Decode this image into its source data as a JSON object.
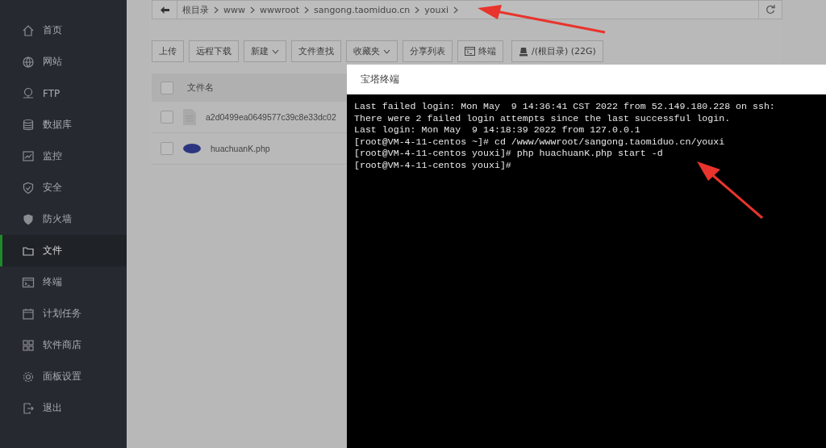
{
  "sidebar": {
    "items": [
      {
        "label": "首页",
        "selected": false
      },
      {
        "label": "网站",
        "selected": false
      },
      {
        "label": "FTP",
        "selected": false
      },
      {
        "label": "数据库",
        "selected": false
      },
      {
        "label": "监控",
        "selected": false
      },
      {
        "label": "安全",
        "selected": false
      },
      {
        "label": "防火墙",
        "selected": false
      },
      {
        "label": "文件",
        "selected": true
      },
      {
        "label": "终端",
        "selected": false
      },
      {
        "label": "计划任务",
        "selected": false
      },
      {
        "label": "软件商店",
        "selected": false
      },
      {
        "label": "面板设置",
        "selected": false
      },
      {
        "label": "退出",
        "selected": false
      }
    ]
  },
  "breadcrumb": [
    "根目录",
    "www",
    "wwwroot",
    "sangong.taomiduo.cn",
    "youxi"
  ],
  "toolbar": [
    {
      "label": "上传",
      "kind": "plain"
    },
    {
      "label": "远程下载",
      "kind": "plain"
    },
    {
      "label": "新建",
      "kind": "dropdown"
    },
    {
      "label": "文件查找",
      "kind": "plain"
    },
    {
      "label": "收藏夹",
      "kind": "dropdown"
    },
    {
      "label": "分享列表",
      "kind": "plain"
    },
    {
      "label": "终端",
      "kind": "terminal"
    },
    {
      "label": "/(根目录) (22G)",
      "kind": "disk"
    }
  ],
  "table": {
    "all_checked": false,
    "columns": [
      "文件名"
    ],
    "rows": [
      {
        "name": "a2d0499ea0649577c39c8e33dc02",
        "kind": "file",
        "checked": false
      },
      {
        "name": "huachuanK.php",
        "kind": "php",
        "checked": false
      }
    ]
  },
  "terminal": {
    "title": "宝塔终端",
    "lines": [
      "Last failed login: Mon May  9 14:36:41 CST 2022 from 52.149.180.228 on ssh:",
      "There were 2 failed login attempts since the last successful login.",
      "Last login: Mon May  9 14:18:39 2022 from 127.0.0.1",
      "[root@VM-4-11-centos ~]# cd /www/wwwroot/sangong.taomiduo.cn/youxi",
      "[root@VM-4-11-centos youxi]# php huachuanK.php start -d",
      "[root@VM-4-11-centos youxi]#"
    ]
  }
}
